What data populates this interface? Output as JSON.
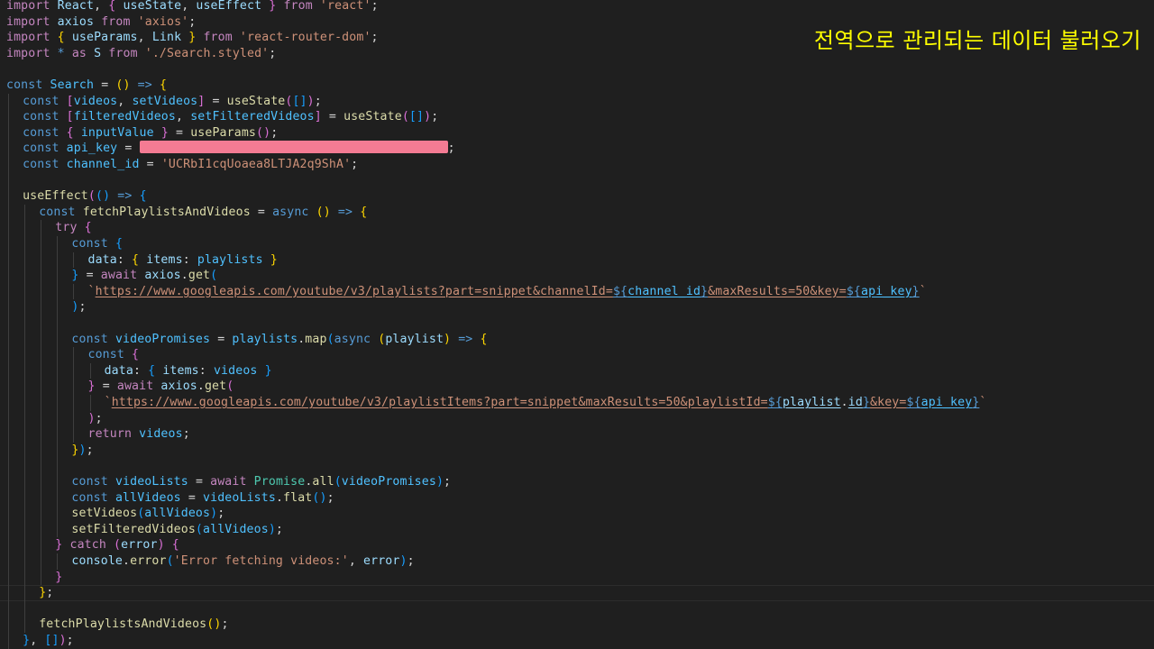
{
  "annotation": "전역으로 관리되는 데이터 불러오기",
  "colors": {
    "background": "#1f1f1f",
    "keyword_blue": "#569cd6",
    "control_purple": "#c586c0",
    "variable": "#9cdcfe",
    "constant": "#4fc1ff",
    "function": "#dcdcaa",
    "string": "#ce9178",
    "type": "#4ec9b0",
    "bracket_gold": "#ffd700",
    "bracket_pink": "#da70d6",
    "bracket_blue": "#179fff",
    "annotation": "#ffff00",
    "redaction": "#f47b93"
  },
  "redacted_secret": "api_key value (redacted)",
  "code_lines": [
    {
      "indent": 0,
      "tokens": [
        [
          "import",
          "kw2"
        ],
        [
          " "
        ],
        [
          "React",
          "var"
        ],
        [
          ", "
        ],
        [
          "{",
          "b2"
        ],
        [
          " "
        ],
        [
          "useState",
          "var"
        ],
        [
          ", "
        ],
        [
          "useEffect",
          "var"
        ],
        [
          " "
        ],
        [
          "}",
          "b2"
        ],
        [
          " "
        ],
        [
          "from",
          "kw2"
        ],
        [
          " "
        ],
        [
          "'react'",
          "str"
        ],
        [
          ";"
        ]
      ]
    },
    {
      "indent": 0,
      "tokens": [
        [
          "import",
          "kw2"
        ],
        [
          " "
        ],
        [
          "axios",
          "var"
        ],
        [
          " "
        ],
        [
          "from",
          "kw2"
        ],
        [
          " "
        ],
        [
          "'axios'",
          "str"
        ],
        [
          ";"
        ]
      ]
    },
    {
      "indent": 0,
      "tokens": [
        [
          "import",
          "kw2"
        ],
        [
          " "
        ],
        [
          "{",
          "b1"
        ],
        [
          " "
        ],
        [
          "useParams",
          "var"
        ],
        [
          ", "
        ],
        [
          "Link",
          "var"
        ],
        [
          " "
        ],
        [
          "}",
          "b1"
        ],
        [
          " "
        ],
        [
          "from",
          "kw2"
        ],
        [
          " "
        ],
        [
          "'react-router-dom'",
          "str"
        ],
        [
          ";"
        ]
      ]
    },
    {
      "indent": 0,
      "tokens": [
        [
          "import",
          "kw2"
        ],
        [
          " "
        ],
        [
          "*",
          "kw"
        ],
        [
          " "
        ],
        [
          "as",
          "kw2"
        ],
        [
          " "
        ],
        [
          "S",
          "var"
        ],
        [
          " "
        ],
        [
          "from",
          "kw2"
        ],
        [
          " "
        ],
        [
          "'./Search.styled'",
          "str"
        ],
        [
          ";"
        ]
      ]
    },
    {
      "indent": 0,
      "tokens": []
    },
    {
      "indent": 0,
      "tokens": [
        [
          "const",
          "kw"
        ],
        [
          " "
        ],
        [
          "Search",
          "const"
        ],
        [
          " "
        ],
        [
          "=",
          "op"
        ],
        [
          " "
        ],
        [
          "()",
          "b1"
        ],
        [
          " "
        ],
        [
          "=>",
          "kw"
        ],
        [
          " "
        ],
        [
          "{",
          "b1"
        ]
      ]
    },
    {
      "indent": 1,
      "tokens": [
        [
          "const",
          "kw"
        ],
        [
          " "
        ],
        [
          "[",
          "b2"
        ],
        [
          "videos",
          "const"
        ],
        [
          ", "
        ],
        [
          "setVideos",
          "const"
        ],
        [
          "]",
          "b2"
        ],
        [
          " "
        ],
        [
          "=",
          "op"
        ],
        [
          " "
        ],
        [
          "useState",
          "fn"
        ],
        [
          "(",
          "b2"
        ],
        [
          "[]",
          "b3"
        ],
        [
          ")",
          "b2"
        ],
        [
          ";"
        ]
      ]
    },
    {
      "indent": 1,
      "tokens": [
        [
          "const",
          "kw"
        ],
        [
          " "
        ],
        [
          "[",
          "b2"
        ],
        [
          "filteredVideos",
          "const"
        ],
        [
          ", "
        ],
        [
          "setFilteredVideos",
          "const"
        ],
        [
          "]",
          "b2"
        ],
        [
          " "
        ],
        [
          "=",
          "op"
        ],
        [
          " "
        ],
        [
          "useState",
          "fn"
        ],
        [
          "(",
          "b2"
        ],
        [
          "[]",
          "b3"
        ],
        [
          ")",
          "b2"
        ],
        [
          ";"
        ]
      ]
    },
    {
      "indent": 1,
      "tokens": [
        [
          "const",
          "kw"
        ],
        [
          " "
        ],
        [
          "{",
          "b2"
        ],
        [
          " "
        ],
        [
          "inputValue",
          "const"
        ],
        [
          " "
        ],
        [
          "}",
          "b2"
        ],
        [
          " "
        ],
        [
          "=",
          "op"
        ],
        [
          " "
        ],
        [
          "useParams",
          "fn"
        ],
        [
          "()",
          "b2"
        ],
        [
          ";"
        ]
      ]
    },
    {
      "indent": 1,
      "tokens": [
        [
          "const",
          "kw"
        ],
        [
          " "
        ],
        [
          "api_key",
          "const"
        ],
        [
          " "
        ],
        [
          "=",
          "op"
        ],
        [
          " "
        ],
        [
          "",
          "redact"
        ],
        [
          ";"
        ]
      ]
    },
    {
      "indent": 1,
      "tokens": [
        [
          "const",
          "kw"
        ],
        [
          " "
        ],
        [
          "channel_id",
          "const"
        ],
        [
          " "
        ],
        [
          "=",
          "op"
        ],
        [
          " "
        ],
        [
          "'UCRbI1cqUoaea8LTJA2q9ShA'",
          "str"
        ],
        [
          ";"
        ]
      ]
    },
    {
      "indent": 0,
      "tokens": []
    },
    {
      "indent": 1,
      "tokens": [
        [
          "useEffect",
          "fn"
        ],
        [
          "(",
          "b2"
        ],
        [
          "()",
          "b3"
        ],
        [
          " "
        ],
        [
          "=>",
          "kw"
        ],
        [
          " "
        ],
        [
          "{",
          "b3"
        ]
      ]
    },
    {
      "indent": 2,
      "tokens": [
        [
          "const",
          "kw"
        ],
        [
          " "
        ],
        [
          "fetchPlaylistsAndVideos",
          "fn"
        ],
        [
          " "
        ],
        [
          "=",
          "op"
        ],
        [
          " "
        ],
        [
          "async",
          "kw"
        ],
        [
          " "
        ],
        [
          "()",
          "b1"
        ],
        [
          " "
        ],
        [
          "=>",
          "kw"
        ],
        [
          " "
        ],
        [
          "{",
          "b1"
        ]
      ]
    },
    {
      "indent": 3,
      "tokens": [
        [
          "try",
          "kw2"
        ],
        [
          " "
        ],
        [
          "{",
          "b2"
        ]
      ]
    },
    {
      "indent": 4,
      "tokens": [
        [
          "const",
          "kw"
        ],
        [
          " "
        ],
        [
          "{",
          "b3"
        ]
      ]
    },
    {
      "indent": 5,
      "tokens": [
        [
          "data",
          "var"
        ],
        [
          ": "
        ],
        [
          "{",
          "b1"
        ],
        [
          " "
        ],
        [
          "items",
          "var"
        ],
        [
          ": "
        ],
        [
          "playlists",
          "const"
        ],
        [
          " "
        ],
        [
          "}",
          "b1"
        ]
      ]
    },
    {
      "indent": 4,
      "tokens": [
        [
          "}",
          "b3"
        ],
        [
          " "
        ],
        [
          "=",
          "op"
        ],
        [
          " "
        ],
        [
          "await",
          "kw2"
        ],
        [
          " "
        ],
        [
          "axios",
          "var"
        ],
        [
          "."
        ],
        [
          "get",
          "fn"
        ],
        [
          "(",
          "b3"
        ]
      ]
    },
    {
      "indent": 5,
      "tokens": [
        [
          "`",
          "str"
        ],
        [
          "https://www.googleapis.com/youtube/v3/playlists?part=snippet&channelId=",
          "str u"
        ],
        [
          "${",
          "kw u"
        ],
        [
          "channel_id",
          "const u"
        ],
        [
          "}",
          "kw u"
        ],
        [
          "&maxResults=50&key=",
          "str u"
        ],
        [
          "${",
          "kw u"
        ],
        [
          "api_key",
          "const u"
        ],
        [
          "}",
          "kw u"
        ],
        [
          "`",
          "str"
        ]
      ]
    },
    {
      "indent": 4,
      "tokens": [
        [
          ")",
          "b3"
        ],
        [
          ";"
        ]
      ]
    },
    {
      "indent": 0,
      "tokens": []
    },
    {
      "indent": 4,
      "tokens": [
        [
          "const",
          "kw"
        ],
        [
          " "
        ],
        [
          "videoPromises",
          "const"
        ],
        [
          " "
        ],
        [
          "=",
          "op"
        ],
        [
          " "
        ],
        [
          "playlists",
          "const"
        ],
        [
          "."
        ],
        [
          "map",
          "fn"
        ],
        [
          "(",
          "b3"
        ],
        [
          "async",
          "kw"
        ],
        [
          " "
        ],
        [
          "(",
          "b1"
        ],
        [
          "playlist",
          "var"
        ],
        [
          ")",
          "b1"
        ],
        [
          " "
        ],
        [
          "=>",
          "kw"
        ],
        [
          " "
        ],
        [
          "{",
          "b1"
        ]
      ]
    },
    {
      "indent": 5,
      "tokens": [
        [
          "const",
          "kw"
        ],
        [
          " "
        ],
        [
          "{",
          "b2"
        ]
      ]
    },
    {
      "indent": 6,
      "tokens": [
        [
          "data",
          "var"
        ],
        [
          ": "
        ],
        [
          "{",
          "b3"
        ],
        [
          " "
        ],
        [
          "items",
          "var"
        ],
        [
          ": "
        ],
        [
          "videos",
          "const"
        ],
        [
          " "
        ],
        [
          "}",
          "b3"
        ]
      ]
    },
    {
      "indent": 5,
      "tokens": [
        [
          "}",
          "b2"
        ],
        [
          " "
        ],
        [
          "=",
          "op"
        ],
        [
          " "
        ],
        [
          "await",
          "kw2"
        ],
        [
          " "
        ],
        [
          "axios",
          "var"
        ],
        [
          "."
        ],
        [
          "get",
          "fn"
        ],
        [
          "(",
          "b2"
        ]
      ]
    },
    {
      "indent": 6,
      "tokens": [
        [
          "`",
          "str"
        ],
        [
          "https://www.googleapis.com/youtube/v3/playlistItems?part=snippet&maxResults=50&playlistId=",
          "str u"
        ],
        [
          "${",
          "kw u"
        ],
        [
          "playlist",
          "var u"
        ],
        [
          "."
        ],
        [
          "id",
          "var u"
        ],
        [
          "}",
          "kw u"
        ],
        [
          "&key=",
          "str u"
        ],
        [
          "${",
          "kw u"
        ],
        [
          "api_key",
          "const u"
        ],
        [
          "}",
          "kw u"
        ],
        [
          "`",
          "str"
        ]
      ]
    },
    {
      "indent": 5,
      "tokens": [
        [
          ")",
          "b2"
        ],
        [
          ";"
        ]
      ]
    },
    {
      "indent": 5,
      "tokens": [
        [
          "return",
          "kw2"
        ],
        [
          " "
        ],
        [
          "videos",
          "const"
        ],
        [
          ";"
        ]
      ]
    },
    {
      "indent": 4,
      "tokens": [
        [
          "}",
          "b1"
        ],
        [
          ")",
          "b3"
        ],
        [
          ";"
        ]
      ]
    },
    {
      "indent": 0,
      "tokens": []
    },
    {
      "indent": 4,
      "tokens": [
        [
          "const",
          "kw"
        ],
        [
          " "
        ],
        [
          "videoLists",
          "const"
        ],
        [
          " "
        ],
        [
          "=",
          "op"
        ],
        [
          " "
        ],
        [
          "await",
          "kw2"
        ],
        [
          " "
        ],
        [
          "Promise",
          "type"
        ],
        [
          "."
        ],
        [
          "all",
          "fn"
        ],
        [
          "(",
          "b3"
        ],
        [
          "videoPromises",
          "const"
        ],
        [
          ")",
          "b3"
        ],
        [
          ";"
        ]
      ]
    },
    {
      "indent": 4,
      "tokens": [
        [
          "const",
          "kw"
        ],
        [
          " "
        ],
        [
          "allVideos",
          "const"
        ],
        [
          " "
        ],
        [
          "=",
          "op"
        ],
        [
          " "
        ],
        [
          "videoLists",
          "const"
        ],
        [
          "."
        ],
        [
          "flat",
          "fn"
        ],
        [
          "()",
          "b3"
        ],
        [
          ";"
        ]
      ]
    },
    {
      "indent": 4,
      "tokens": [
        [
          "setVideos",
          "fn"
        ],
        [
          "(",
          "b3"
        ],
        [
          "allVideos",
          "const"
        ],
        [
          ")",
          "b3"
        ],
        [
          ";"
        ]
      ]
    },
    {
      "indent": 4,
      "tokens": [
        [
          "setFilteredVideos",
          "fn"
        ],
        [
          "(",
          "b3"
        ],
        [
          "allVideos",
          "const"
        ],
        [
          ")",
          "b3"
        ],
        [
          ";"
        ]
      ]
    },
    {
      "indent": 3,
      "tokens": [
        [
          "}",
          "b2"
        ],
        [
          " "
        ],
        [
          "catch",
          "kw2"
        ],
        [
          " "
        ],
        [
          "(",
          "b2"
        ],
        [
          "error",
          "var"
        ],
        [
          ")",
          "b2"
        ],
        [
          " "
        ],
        [
          "{",
          "b2"
        ]
      ]
    },
    {
      "indent": 4,
      "tokens": [
        [
          "console",
          "var"
        ],
        [
          "."
        ],
        [
          "error",
          "fn"
        ],
        [
          "(",
          "b3"
        ],
        [
          "'Error fetching videos:'",
          "str"
        ],
        [
          ", "
        ],
        [
          "error",
          "var"
        ],
        [
          ")",
          "b3"
        ],
        [
          ";"
        ]
      ]
    },
    {
      "indent": 3,
      "tokens": [
        [
          "}",
          "b2"
        ]
      ]
    },
    {
      "indent": 2,
      "tokens": [
        [
          "}",
          "b1"
        ],
        [
          ";"
        ]
      ]
    },
    {
      "indent": 0,
      "tokens": []
    },
    {
      "indent": 2,
      "tokens": [
        [
          "fetchPlaylistsAndVideos",
          "fn"
        ],
        [
          "()",
          "b1"
        ],
        [
          ";"
        ]
      ]
    },
    {
      "indent": 1,
      "tokens": [
        [
          "}",
          "b3"
        ],
        [
          ", "
        ],
        [
          "[]",
          "b3"
        ],
        [
          ")",
          "b2"
        ],
        [
          ";"
        ]
      ]
    }
  ]
}
